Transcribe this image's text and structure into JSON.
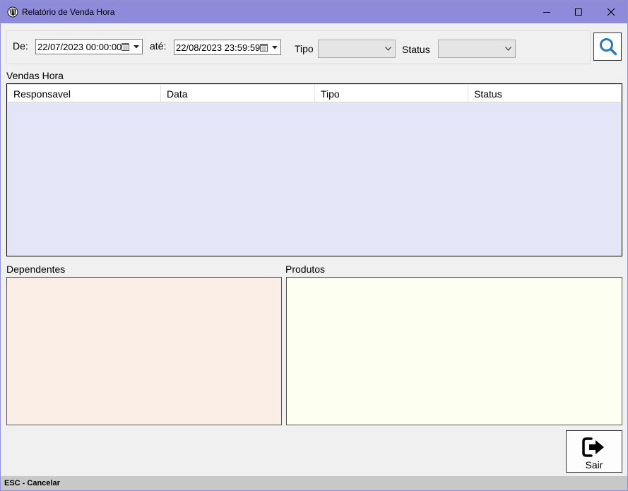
{
  "window": {
    "title": "Relatório de Venda Hora"
  },
  "filters": {
    "from_label": "De:",
    "from_value": "22/07/2023 00:00:00",
    "to_label": "até:",
    "to_value": "22/08/2023 23:59:59",
    "tipo_label": "Tipo",
    "tipo_value": "",
    "status_label": "Status",
    "status_value": ""
  },
  "vendas": {
    "title": "Vendas Hora",
    "columns": [
      "Responsavel",
      "Data",
      "Tipo",
      "Status"
    ],
    "rows": []
  },
  "dependentes": {
    "title": "Dependentes"
  },
  "produtos": {
    "title": "Produtos"
  },
  "actions": {
    "sair_label": "Sair"
  },
  "statusbar": {
    "text": "ESC - Cancelar"
  },
  "colors": {
    "titlebar": "#8e8bdb",
    "grid_bg": "#e5e5f8",
    "dependentes_bg": "#fbeee6",
    "produtos_bg": "#fdfff0",
    "search_icon": "#2a7ab8"
  }
}
